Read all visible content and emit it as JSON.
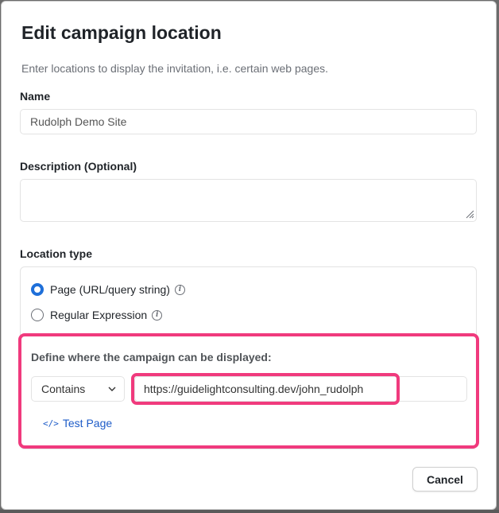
{
  "dialog": {
    "title": "Edit campaign location",
    "subtitle": "Enter locations to display the invitation, i.e. certain web pages."
  },
  "name_field": {
    "label": "Name",
    "value": "Rudolph Demo Site"
  },
  "description_field": {
    "label": "Description (Optional)",
    "value": ""
  },
  "location_type": {
    "label": "Location type",
    "options": [
      {
        "label": "Page (URL/query string)",
        "selected": true
      },
      {
        "label": "Regular Expression",
        "selected": false
      }
    ]
  },
  "definition": {
    "label": "Define where the campaign can be displayed:",
    "match_type": "Contains",
    "url_value": "https://guidelightconsulting.dev/john_rudolph",
    "test_link": "Test Page"
  },
  "footer": {
    "cancel_label": "Cancel"
  },
  "colors": {
    "accent": "#1e6fd9",
    "highlight": "#f03a7d",
    "link": "#1e5cc8"
  },
  "icons": {
    "info": "info-icon",
    "code": "code-icon",
    "chevron": "chevron-down-icon"
  }
}
